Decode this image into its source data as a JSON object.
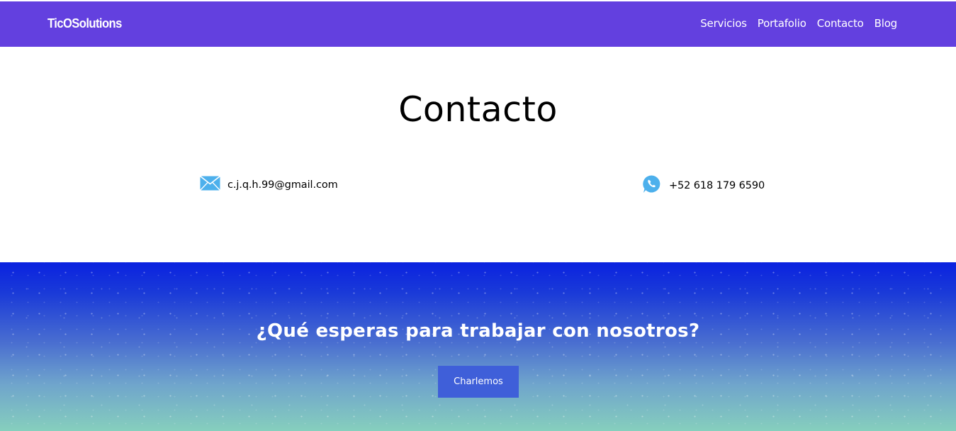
{
  "nav": {
    "brand": "TicOSolutions",
    "links": [
      "Servicios",
      "Portafolio",
      "Contacto",
      "Blog"
    ]
  },
  "contact": {
    "title": "Contacto",
    "email": "c.j.q.h.99@gmail.com",
    "phone": "+52 618 179 6590"
  },
  "cta": {
    "heading": "¿Qué esperas para trabajar con nosotros?",
    "button_label": "Charlemos"
  },
  "icons": {
    "email": "envelope-icon",
    "phone": "whatsapp-icon"
  },
  "colors": {
    "navbar": "#6340df",
    "cta_gradient_top": "#0a22e0",
    "cta_gradient_bottom": "#86cfbd",
    "button": "#3f5fd9",
    "icon_blue": "#4db0ec"
  }
}
